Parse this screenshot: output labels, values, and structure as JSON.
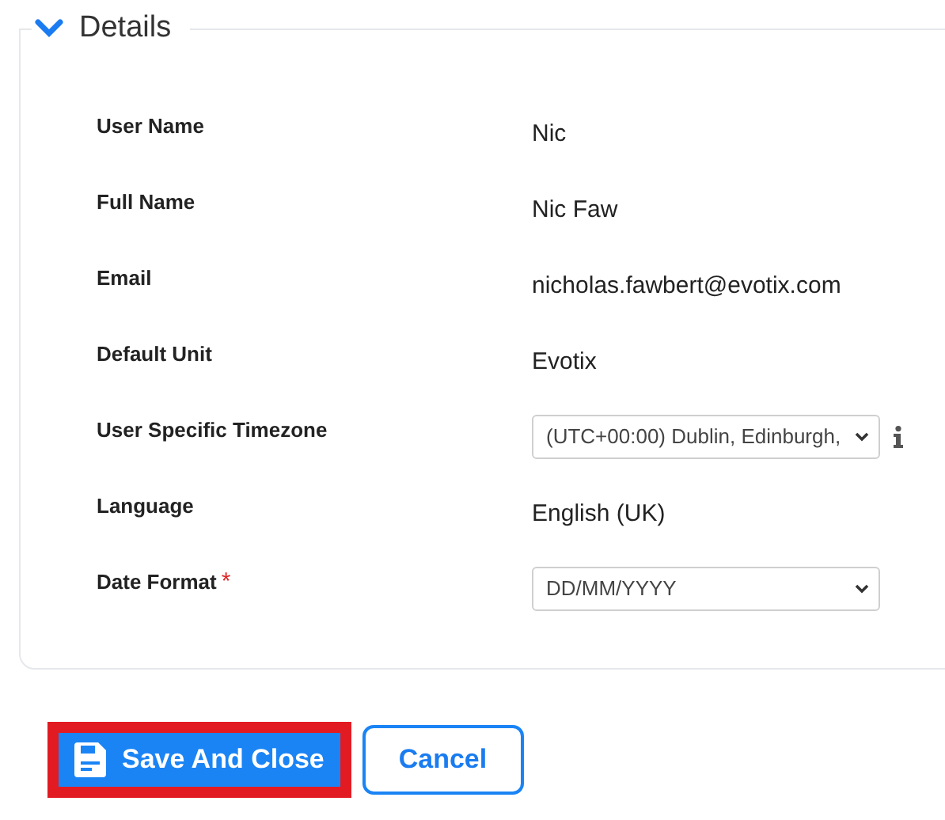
{
  "section": {
    "title": "Details",
    "expanded": true
  },
  "fields": [
    {
      "label": "User Name",
      "kind": "text",
      "value": "Nic"
    },
    {
      "label": "Full Name",
      "kind": "text",
      "value": "Nic Faw"
    },
    {
      "label": "Email",
      "kind": "text",
      "value": "nicholas.fawbert@evotix.com"
    },
    {
      "label": "Default Unit",
      "kind": "text",
      "value": "Evotix"
    },
    {
      "label": "User Specific Timezone",
      "kind": "select",
      "value": "(UTC+00:00) Dublin, Edinburgh,",
      "info": true
    },
    {
      "label": "Language",
      "kind": "text",
      "value": "English (UK)"
    },
    {
      "label": "Date Format",
      "kind": "select",
      "value": "DD/MM/YYYY",
      "required": true,
      "required_mark": "*"
    }
  ],
  "buttons": [
    {
      "label": "Save And Close",
      "kind": "primary",
      "highlighted": true
    },
    {
      "label": "Cancel",
      "kind": "secondary",
      "highlighted": false
    }
  ]
}
